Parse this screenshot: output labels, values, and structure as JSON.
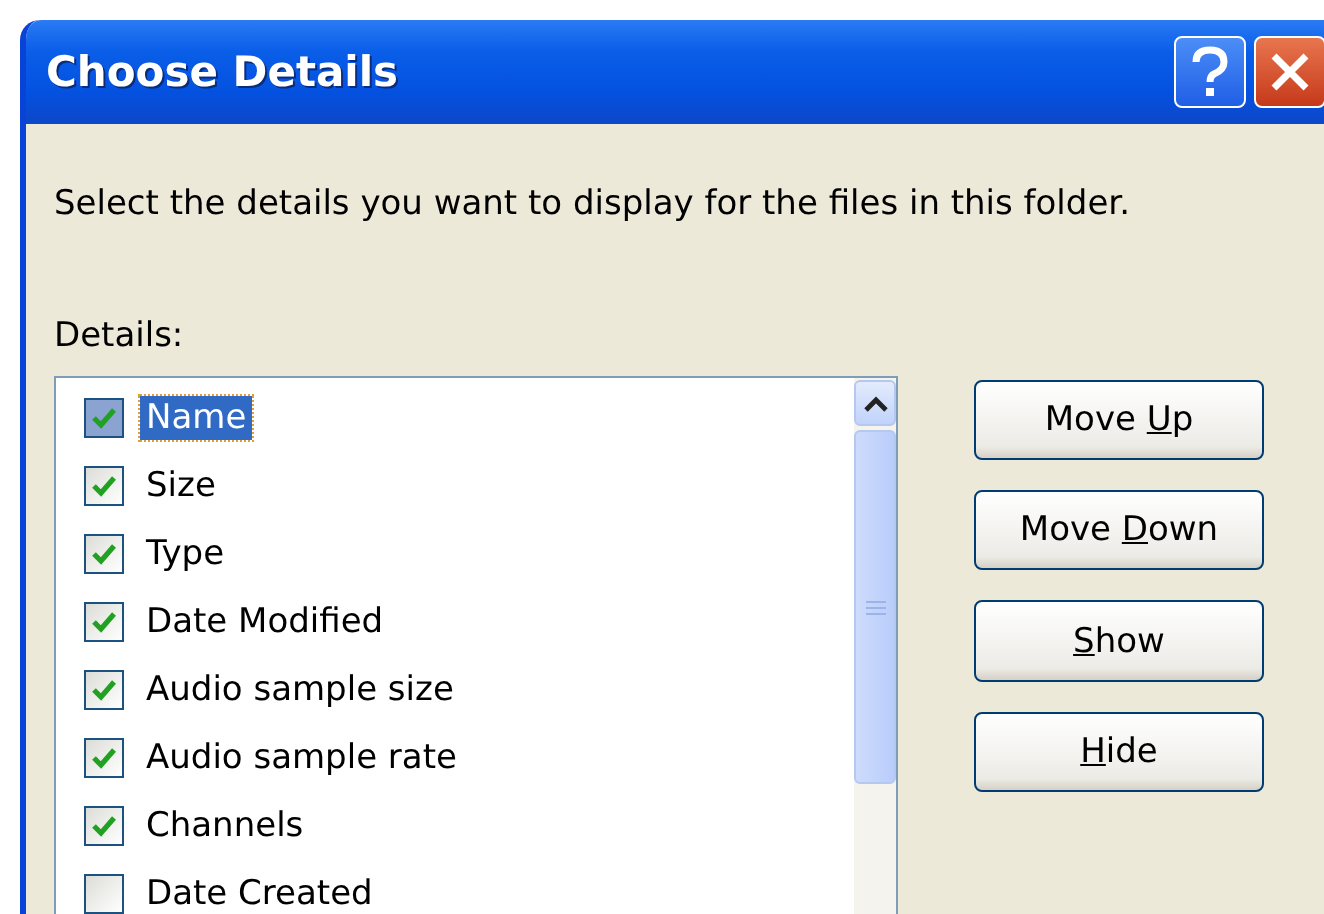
{
  "window": {
    "title": "Choose Details"
  },
  "instruction": "Select the details you want to display for the files in this folder.",
  "details_label": "Details:",
  "details": [
    {
      "label": "Name",
      "checked": true,
      "selected": true
    },
    {
      "label": "Size",
      "checked": true,
      "selected": false
    },
    {
      "label": "Type",
      "checked": true,
      "selected": false
    },
    {
      "label": "Date Modified",
      "checked": true,
      "selected": false
    },
    {
      "label": "Audio sample size",
      "checked": true,
      "selected": false
    },
    {
      "label": "Audio sample rate",
      "checked": true,
      "selected": false
    },
    {
      "label": "Channels",
      "checked": true,
      "selected": false
    },
    {
      "label": "Date Created",
      "checked": false,
      "selected": false
    }
  ],
  "buttons": [
    {
      "before": "Move ",
      "key": "U",
      "after": "p"
    },
    {
      "before": "Move ",
      "key": "D",
      "after": "own"
    },
    {
      "key": "S",
      "after": "how"
    },
    {
      "key": "H",
      "after": "ide"
    }
  ]
}
